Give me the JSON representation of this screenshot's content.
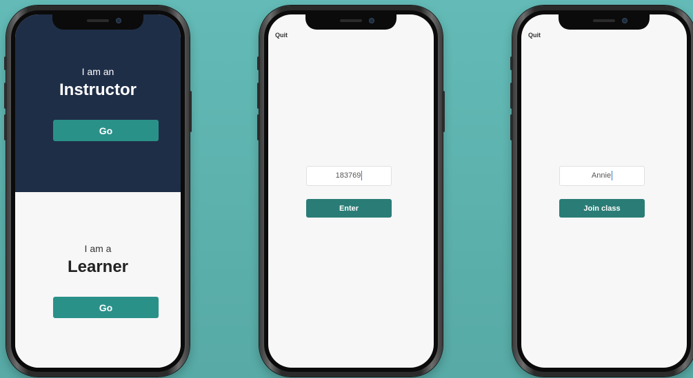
{
  "colors": {
    "background": "#5fb3af",
    "instructor_panel": "#1f2e47",
    "go_button": "#2a9189",
    "action_button": "#2a7d76",
    "screen": "#f7f7f7"
  },
  "phone1": {
    "instructor": {
      "intro": "I am an",
      "title": "Instructor",
      "button": "Go"
    },
    "learner": {
      "intro": "I am a",
      "title": "Learner",
      "button": "Go"
    }
  },
  "phone2": {
    "quit": "Quit",
    "code_input_value": "183769",
    "button": "Enter"
  },
  "phone3": {
    "quit": "Quit",
    "name_input_value": "Annie",
    "button": "Join class"
  }
}
